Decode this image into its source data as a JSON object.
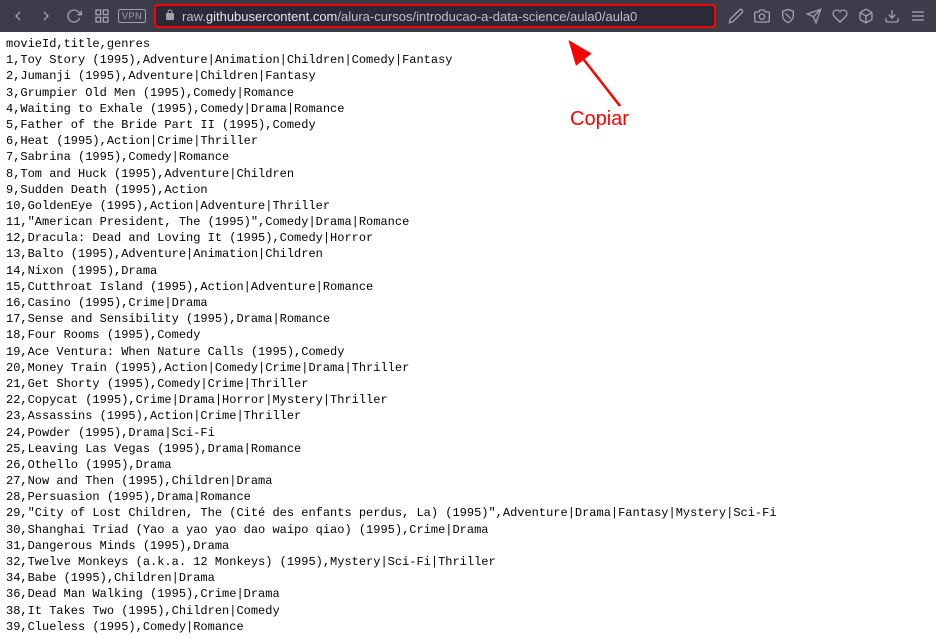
{
  "toolbar": {
    "vpn_label": "VPN",
    "url_prefix": "raw.",
    "url_domain": "githubusercontent.com",
    "url_path": "/alura-cursos/introducao-a-data-science/aula0/aula0"
  },
  "annotation": {
    "label": "Copiar"
  },
  "csv_lines": [
    "movieId,title,genres",
    "1,Toy Story (1995),Adventure|Animation|Children|Comedy|Fantasy",
    "2,Jumanji (1995),Adventure|Children|Fantasy",
    "3,Grumpier Old Men (1995),Comedy|Romance",
    "4,Waiting to Exhale (1995),Comedy|Drama|Romance",
    "5,Father of the Bride Part II (1995),Comedy",
    "6,Heat (1995),Action|Crime|Thriller",
    "7,Sabrina (1995),Comedy|Romance",
    "8,Tom and Huck (1995),Adventure|Children",
    "9,Sudden Death (1995),Action",
    "10,GoldenEye (1995),Action|Adventure|Thriller",
    "11,\"American President, The (1995)\",Comedy|Drama|Romance",
    "12,Dracula: Dead and Loving It (1995),Comedy|Horror",
    "13,Balto (1995),Adventure|Animation|Children",
    "14,Nixon (1995),Drama",
    "15,Cutthroat Island (1995),Action|Adventure|Romance",
    "16,Casino (1995),Crime|Drama",
    "17,Sense and Sensibility (1995),Drama|Romance",
    "18,Four Rooms (1995),Comedy",
    "19,Ace Ventura: When Nature Calls (1995),Comedy",
    "20,Money Train (1995),Action|Comedy|Crime|Drama|Thriller",
    "21,Get Shorty (1995),Comedy|Crime|Thriller",
    "22,Copycat (1995),Crime|Drama|Horror|Mystery|Thriller",
    "23,Assassins (1995),Action|Crime|Thriller",
    "24,Powder (1995),Drama|Sci-Fi",
    "25,Leaving Las Vegas (1995),Drama|Romance",
    "26,Othello (1995),Drama",
    "27,Now and Then (1995),Children|Drama",
    "28,Persuasion (1995),Drama|Romance",
    "29,\"City of Lost Children, The (Cité des enfants perdus, La) (1995)\",Adventure|Drama|Fantasy|Mystery|Sci-Fi",
    "30,Shanghai Triad (Yao a yao yao dao waipo qiao) (1995),Crime|Drama",
    "31,Dangerous Minds (1995),Drama",
    "32,Twelve Monkeys (a.k.a. 12 Monkeys) (1995),Mystery|Sci-Fi|Thriller",
    "34,Babe (1995),Children|Drama",
    "36,Dead Man Walking (1995),Crime|Drama",
    "38,It Takes Two (1995),Children|Comedy",
    "39,Clueless (1995),Comedy|Romance"
  ]
}
